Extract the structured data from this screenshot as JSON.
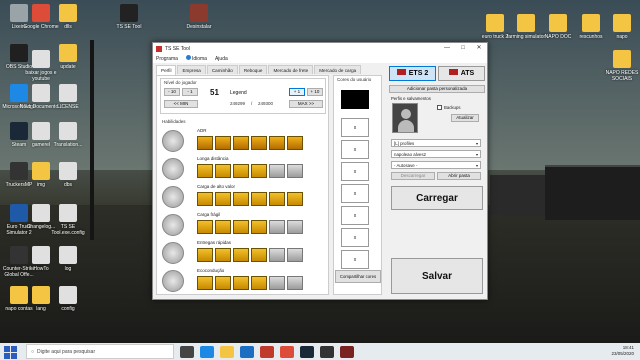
{
  "desktop": {
    "icons_left": [
      {
        "label": "Lixeira",
        "color": "#9aa3a8"
      },
      {
        "label": "Google Chrome",
        "color": "#dd4b39"
      },
      {
        "label": "dlls",
        "color": "#f4c542"
      },
      {
        "label": "TS SE Tool",
        "color": "#222222"
      },
      {
        "label": "Desinstalar",
        "color": "#8c3a2e"
      },
      {
        "label": "euro truck 2",
        "color": "#f4c542"
      },
      {
        "label": "farming simulator",
        "color": "#f4c542"
      },
      {
        "label": "NAPO DOC",
        "color": "#f4c542"
      },
      {
        "label": "rescunhos",
        "color": "#f4c542"
      },
      {
        "label": "napo",
        "color": "#f4c542"
      },
      {
        "label": "OBS Studio",
        "color": "#202020"
      },
      {
        "label": "baixar jogos e youtube",
        "color": "#e0e0e0"
      },
      {
        "label": "update",
        "color": "#f4c542"
      },
      {
        "label": "NAPO REDES SOCIAIS",
        "color": "#f4c542"
      },
      {
        "label": "Microsoft Edge",
        "color": "#1e88e5"
      },
      {
        "label": "Novo Documento...",
        "color": "#e0e0e0"
      },
      {
        "label": "LICENSE",
        "color": "#e0e0e0"
      },
      {
        "label": "Steam",
        "color": "#1b2838"
      },
      {
        "label": "gamerel",
        "color": "#e0e0e0"
      },
      {
        "label": "Translation...",
        "color": "#e0e0e0"
      },
      {
        "label": "TruckersMP",
        "color": "#333333"
      },
      {
        "label": "img",
        "color": "#f4c542"
      },
      {
        "label": "dbs",
        "color": "#e0e0e0"
      },
      {
        "label": "Euro Truck Simulator 2",
        "color": "#1e5aa8"
      },
      {
        "label": "Changelog...",
        "color": "#e0e0e0"
      },
      {
        "label": "TS SE Tool.exe.config",
        "color": "#e0e0e0"
      },
      {
        "label": "Counter-Strike Global Offe...",
        "color": "#333333"
      },
      {
        "label": "HowTo",
        "color": "#e0e0e0"
      },
      {
        "label": "log",
        "color": "#e0e0e0"
      },
      {
        "label": "napo contas",
        "color": "#f4c542"
      },
      {
        "label": "lang",
        "color": "#f4c542"
      },
      {
        "label": "config",
        "color": "#e0e0e0"
      }
    ]
  },
  "window": {
    "title": "TS SE Tool",
    "minimize": "—",
    "maximize": "□",
    "close": "✕",
    "menu": [
      "Programa",
      "Idioma",
      "Ajuda"
    ],
    "tabs": [
      "Perfil",
      "Empresa",
      "Caminhão",
      "Reboque",
      "Mercado de frete",
      "Mercado de carga"
    ],
    "player_level": {
      "title": "Nível do jogador",
      "minus10": "- 10",
      "minus1": "- 1",
      "min_btn": "<< MIN",
      "level": "51",
      "level_name": "Legend",
      "xp_current": "249299",
      "xp_separator": "/",
      "xp_max": "249300",
      "plus1": "+ 1",
      "plus10": "+ 10",
      "max_btn": "MAX >>"
    },
    "skills": {
      "title": "Habilidades",
      "list": [
        {
          "name": "ADR",
          "filled": 6,
          "total": 6
        },
        {
          "name": "Longa distância",
          "filled": 4,
          "total": 6
        },
        {
          "name": "Carga de alto valor",
          "filled": 6,
          "total": 6
        },
        {
          "name": "Carga frágil",
          "filled": 4,
          "total": 6
        },
        {
          "name": "Entregas rápidas",
          "filled": 4,
          "total": 6
        },
        {
          "name": "Ecocondução",
          "filled": 4,
          "total": 6
        }
      ]
    },
    "user_colors": {
      "title": "Cores do usuário",
      "slot_label": "x",
      "share_button": "Compartilhar cores"
    },
    "right": {
      "ets2": "ETS 2",
      "ats": "ATS",
      "add_folder": "Adicionar pasta personalizada",
      "profiles_title": "Perfis e salvamentos",
      "backups": "Backups",
      "update": "Atualizar",
      "profile_path": "[L] profiles",
      "profile_name": "napoleao alves2",
      "save_name": "- Autosave -",
      "unload": "Descarregar",
      "open_folder": "Abrir pasta",
      "load": "Carregar",
      "save": "Salvar"
    }
  },
  "taskbar": {
    "search_placeholder": "Digite aqui para pesquisar",
    "time": "18:41",
    "date": "23/05/2020"
  }
}
